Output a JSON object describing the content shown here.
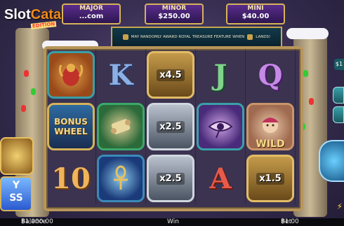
{
  "watermark": {
    "slot": "Slot",
    "catalog": "Catalog",
    "edition": "EDITION",
    "game_title_fragment": "MY'S"
  },
  "jackpots": [
    {
      "id": "major",
      "label": "MAJOR",
      "value": "...com"
    },
    {
      "id": "minor",
      "label": "MINOR",
      "value": "$250.00"
    },
    {
      "id": "mini",
      "label": "MINI",
      "value": "$40.00"
    }
  ],
  "banner": {
    "text_before": "MAY RANDOMLY AWARD ROYAL TREASURE FEATURE WHEN",
    "text_after": "LANDS!"
  },
  "reels": [
    {
      "col": 1,
      "symbols": [
        "scarab",
        "bonus-wheel",
        "10"
      ]
    },
    {
      "col": 2,
      "symbols": [
        "K",
        "scroll",
        "ankh"
      ]
    },
    {
      "col": 3,
      "symbols": [
        "x4.5",
        "x2.5",
        "x2.5"
      ]
    },
    {
      "col": 4,
      "symbols": [
        "J",
        "eye",
        "A"
      ]
    },
    {
      "col": 5,
      "symbols": [
        "Q",
        "wild",
        "x1.5"
      ]
    }
  ],
  "symbol_text": {
    "k": "K",
    "j": "J",
    "q": "Q",
    "ten": "10",
    "a": "A",
    "mult_45": "x4.5",
    "mult_25a": "x2.5",
    "mult_25b": "x2.5",
    "mult_15": "x1.5",
    "bonus_line1": "BONUS",
    "bonus_line2": "WHEEL",
    "wild": "WILD"
  },
  "left_panel": {
    "line1": "Y",
    "line2": "SS"
  },
  "right_panel": {
    "small_value": "$1"
  },
  "bottom_bar": {
    "balance_label": "Balance",
    "balance_value": "$1,000.00",
    "win_label": "Win",
    "bet_label": "Bet",
    "bet_value": "$1.00"
  },
  "colors": {
    "frame_gold": "#b8955a",
    "jackpot_purple": "#5a2d8c",
    "watermark_accent": "#f08a1a"
  }
}
